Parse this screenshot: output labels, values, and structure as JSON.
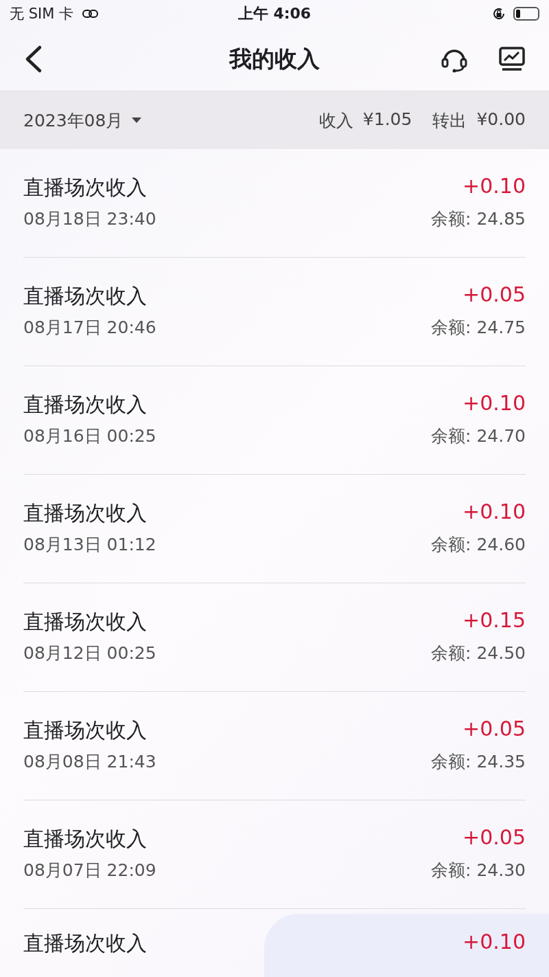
{
  "status_bar": {
    "carrier": "无 SIM 卡",
    "time": "上午 4:06"
  },
  "header": {
    "title": "我的收入"
  },
  "summary": {
    "month": "2023年08月",
    "income_label": "收入",
    "income": "¥1.05",
    "transfer_label": "转出",
    "transfer": "¥0.00"
  },
  "records": [
    {
      "title": "直播场次收入",
      "time": "08月18日 23:40",
      "amount": "+0.10",
      "balance": "余额: 24.85"
    },
    {
      "title": "直播场次收入",
      "time": "08月17日 20:46",
      "amount": "+0.05",
      "balance": "余额: 24.75"
    },
    {
      "title": "直播场次收入",
      "time": "08月16日 00:25",
      "amount": "+0.10",
      "balance": "余额: 24.70"
    },
    {
      "title": "直播场次收入",
      "time": "08月13日 01:12",
      "amount": "+0.10",
      "balance": "余额: 24.60"
    },
    {
      "title": "直播场次收入",
      "time": "08月12日 00:25",
      "amount": "+0.15",
      "balance": "余额: 24.50"
    },
    {
      "title": "直播场次收入",
      "time": "08月08日 21:43",
      "amount": "+0.05",
      "balance": "余额: 24.35"
    },
    {
      "title": "直播场次收入",
      "time": "08月07日 22:09",
      "amount": "+0.05",
      "balance": "余额: 24.30"
    },
    {
      "title": "直播场次收入",
      "amount": "+0.10"
    }
  ]
}
